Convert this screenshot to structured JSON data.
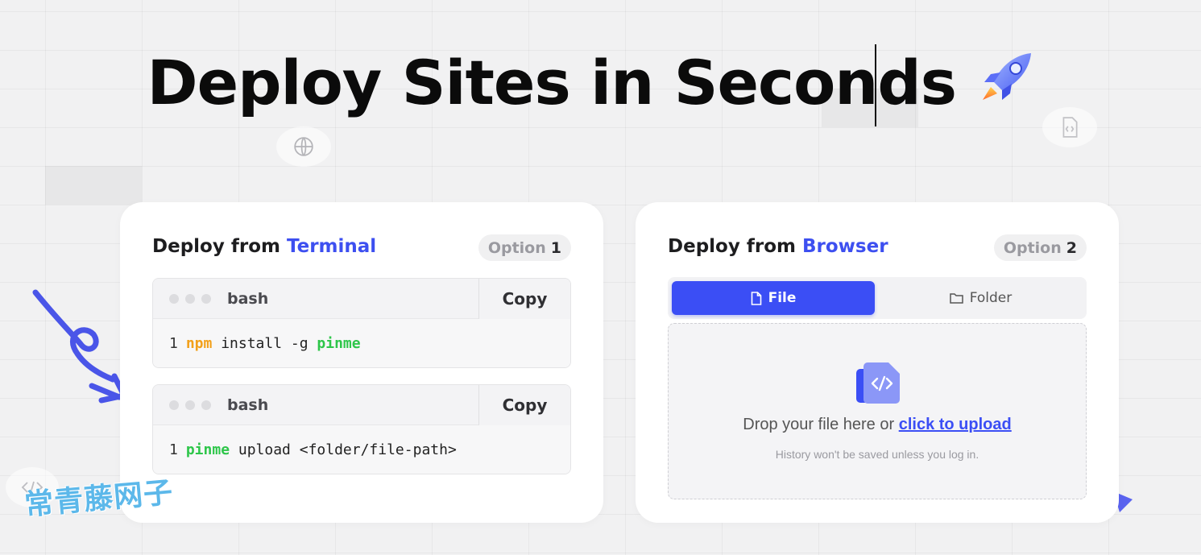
{
  "hero": {
    "title": "Deploy Sites in Seconds"
  },
  "terminal_card": {
    "title_prefix": "Deploy from",
    "title_accent": "Terminal",
    "option_label": "Option",
    "option_num": "1",
    "blocks": [
      {
        "lang": "bash",
        "copy_label": "Copy",
        "line_no": "1",
        "tokens": [
          {
            "text": "npm",
            "style": "orange"
          },
          {
            "text": " install -g ",
            "style": "plain"
          },
          {
            "text": "pinme",
            "style": "green"
          }
        ]
      },
      {
        "lang": "bash",
        "copy_label": "Copy",
        "line_no": "1",
        "tokens": [
          {
            "text": "pinme",
            "style": "green"
          },
          {
            "text": " upload <folder/file-path>",
            "style": "plain"
          }
        ]
      }
    ]
  },
  "browser_card": {
    "title_prefix": "Deploy from",
    "title_accent": "Browser",
    "option_label": "Option",
    "option_num": "2",
    "tabs": {
      "file": "File",
      "folder": "Folder",
      "selected": "File"
    },
    "dropzone": {
      "text": "Drop your file here or",
      "link": "click to upload",
      "hint": "History won't be saved unless you log in."
    }
  },
  "watermark": "常青藤网子",
  "colors": {
    "accent": "#3b4ef5",
    "npm_token": "#f2a01a",
    "pinme_token": "#2ec64a",
    "background": "#f1f1f2"
  },
  "icons": [
    "rocket-icon",
    "globe-icon",
    "code-file-icon",
    "code-icon",
    "file-icon",
    "folder-icon",
    "upload-code-file-icon"
  ]
}
